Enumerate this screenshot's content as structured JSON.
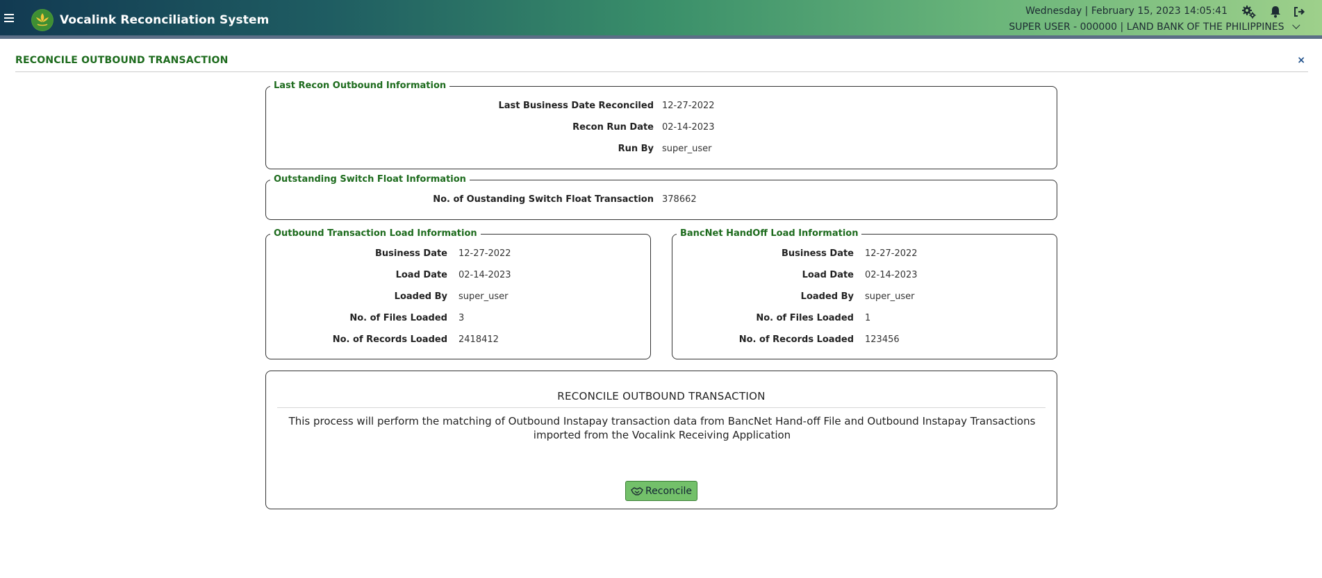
{
  "header": {
    "app_title": "Vocalink Reconciliation System",
    "datetime": "Wednesday | February 15, 2023 14:05:41",
    "user": "SUPER USER - 000000 | LAND BANK OF THE PHILIPPINES",
    "icons": [
      "menu-icon",
      "logo-icon",
      "settings-icon",
      "bell-icon",
      "logout-icon"
    ]
  },
  "page": {
    "title": "RECONCILE OUTBOUND TRANSACTION",
    "close": "×"
  },
  "last_recon": {
    "legend": "Last Recon Outbound Information",
    "rows": [
      {
        "label": "Last Business Date Reconciled",
        "value": "12-27-2022"
      },
      {
        "label": "Recon Run Date",
        "value": "02-14-2023"
      },
      {
        "label": "Run By",
        "value": "super_user"
      }
    ]
  },
  "switch_float": {
    "legend": "Outstanding Switch Float Information",
    "rows": [
      {
        "label": "No. of Oustanding Switch Float Transaction",
        "value": "378662"
      }
    ]
  },
  "outbound_load": {
    "legend": "Outbound Transaction Load Information",
    "rows": [
      {
        "label": "Business Date",
        "value": "12-27-2022"
      },
      {
        "label": "Load Date",
        "value": "02-14-2023"
      },
      {
        "label": "Loaded By",
        "value": "super_user"
      },
      {
        "label": "No. of Files Loaded",
        "value": "3"
      },
      {
        "label": "No. of Records Loaded",
        "value": "2418412"
      }
    ]
  },
  "bancnet_load": {
    "legend": "BancNet HandOff Load Information",
    "rows": [
      {
        "label": "Business Date",
        "value": "12-27-2022"
      },
      {
        "label": "Load Date",
        "value": "02-14-2023"
      },
      {
        "label": "Loaded By",
        "value": "super_user"
      },
      {
        "label": "No. of Files Loaded",
        "value": "1"
      },
      {
        "label": "No. of Records Loaded",
        "value": "123456"
      }
    ]
  },
  "reconcile_panel": {
    "heading": "RECONCILE OUTBOUND TRANSACTION",
    "description": "This process will perform the matching of Outbound Instapay transaction data from BancNet Hand-off File and Outbound Instapay Transactions imported from the Vocalink Receiving Application",
    "button_label": "Reconcile",
    "button_icon": "handshake-icon"
  },
  "colors": {
    "accent_green": "#1d6b1d",
    "button_green": "#73c06a",
    "topbar_start": "#123a52",
    "topbar_end": "#9ed08b"
  }
}
